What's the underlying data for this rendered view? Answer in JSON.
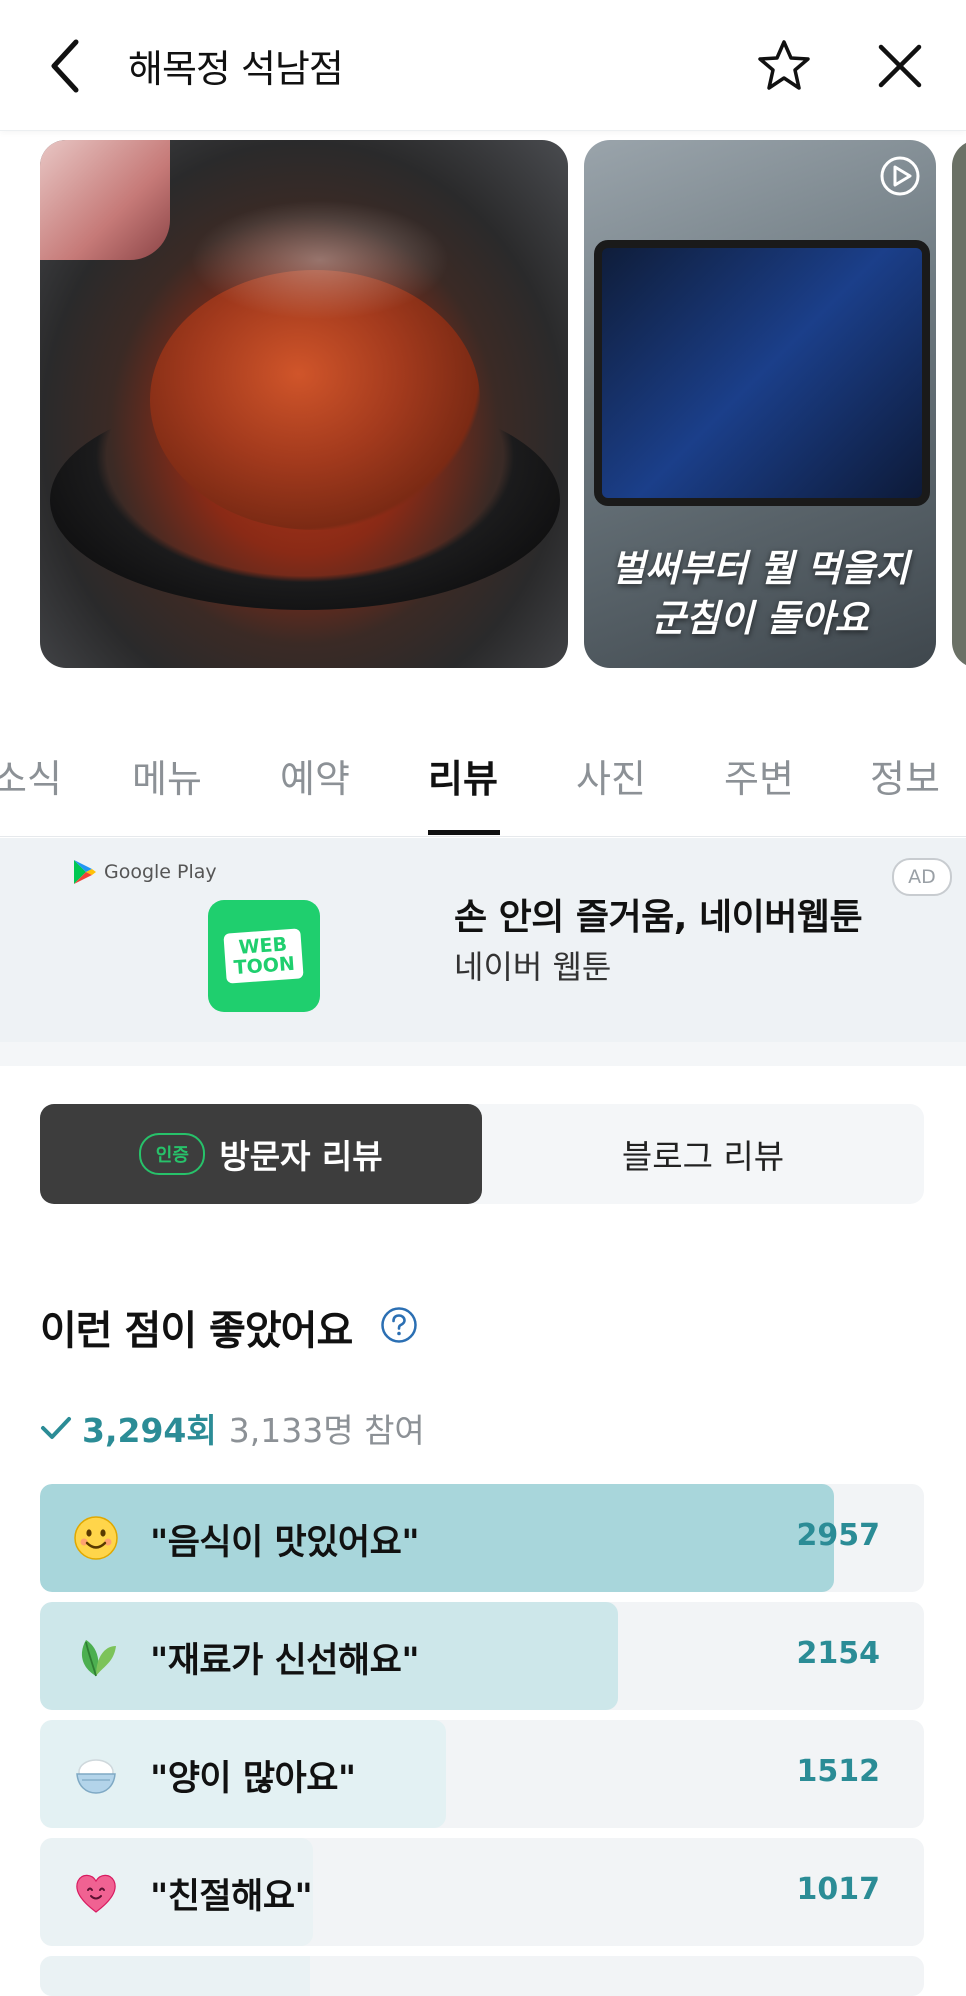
{
  "header": {
    "title": "해목정 석남점",
    "back_icon": "chevron-left-icon",
    "favorite_icon": "star-icon",
    "close_icon": "close-icon"
  },
  "carousel": {
    "video_caption_line1": "벌써부터 뭘 먹을지",
    "video_caption_line2": "군침이 돌아요"
  },
  "tabs": [
    {
      "label": "소식"
    },
    {
      "label": "메뉴"
    },
    {
      "label": "예약"
    },
    {
      "label": "리뷰",
      "active": true
    },
    {
      "label": "사진"
    },
    {
      "label": "주변"
    },
    {
      "label": "정보"
    }
  ],
  "ad": {
    "store": "Google Play",
    "badge": "AD",
    "logo_line1": "WEB",
    "logo_line2": "TOON",
    "title": "손 안의 즐거움, 네이버웹툰",
    "subtitle": "네이버 웹툰"
  },
  "review_toggle": {
    "cert_badge": "인증",
    "visitor": "방문자 리뷰",
    "blog": "블로그 리뷰",
    "selected": "visitor"
  },
  "keywords": {
    "title": "이런 점이 좋았어요",
    "total_votes": "3,294회",
    "participants": "3,133명 참여",
    "max_value": 3294,
    "items": [
      {
        "label": "\"음식이 맛있어요\"",
        "count": "2957",
        "value": 2957,
        "icon": "smiling-face-icon"
      },
      {
        "label": "\"재료가 신선해요\"",
        "count": "2154",
        "value": 2154,
        "icon": "leaf-icon"
      },
      {
        "label": "\"양이 많아요\"",
        "count": "1512",
        "value": 1512,
        "icon": "rice-bowl-icon"
      },
      {
        "label": "\"친절해요\"",
        "count": "1017",
        "value": 1017,
        "icon": "heart-face-icon"
      }
    ]
  },
  "colors": {
    "accent_teal": "#2b8c96",
    "bar_strong": "#a8d6db",
    "bar_mid": "#cde7ea",
    "bar_light": "#e3f1f3",
    "bar_faint": "#eaf2f4"
  }
}
